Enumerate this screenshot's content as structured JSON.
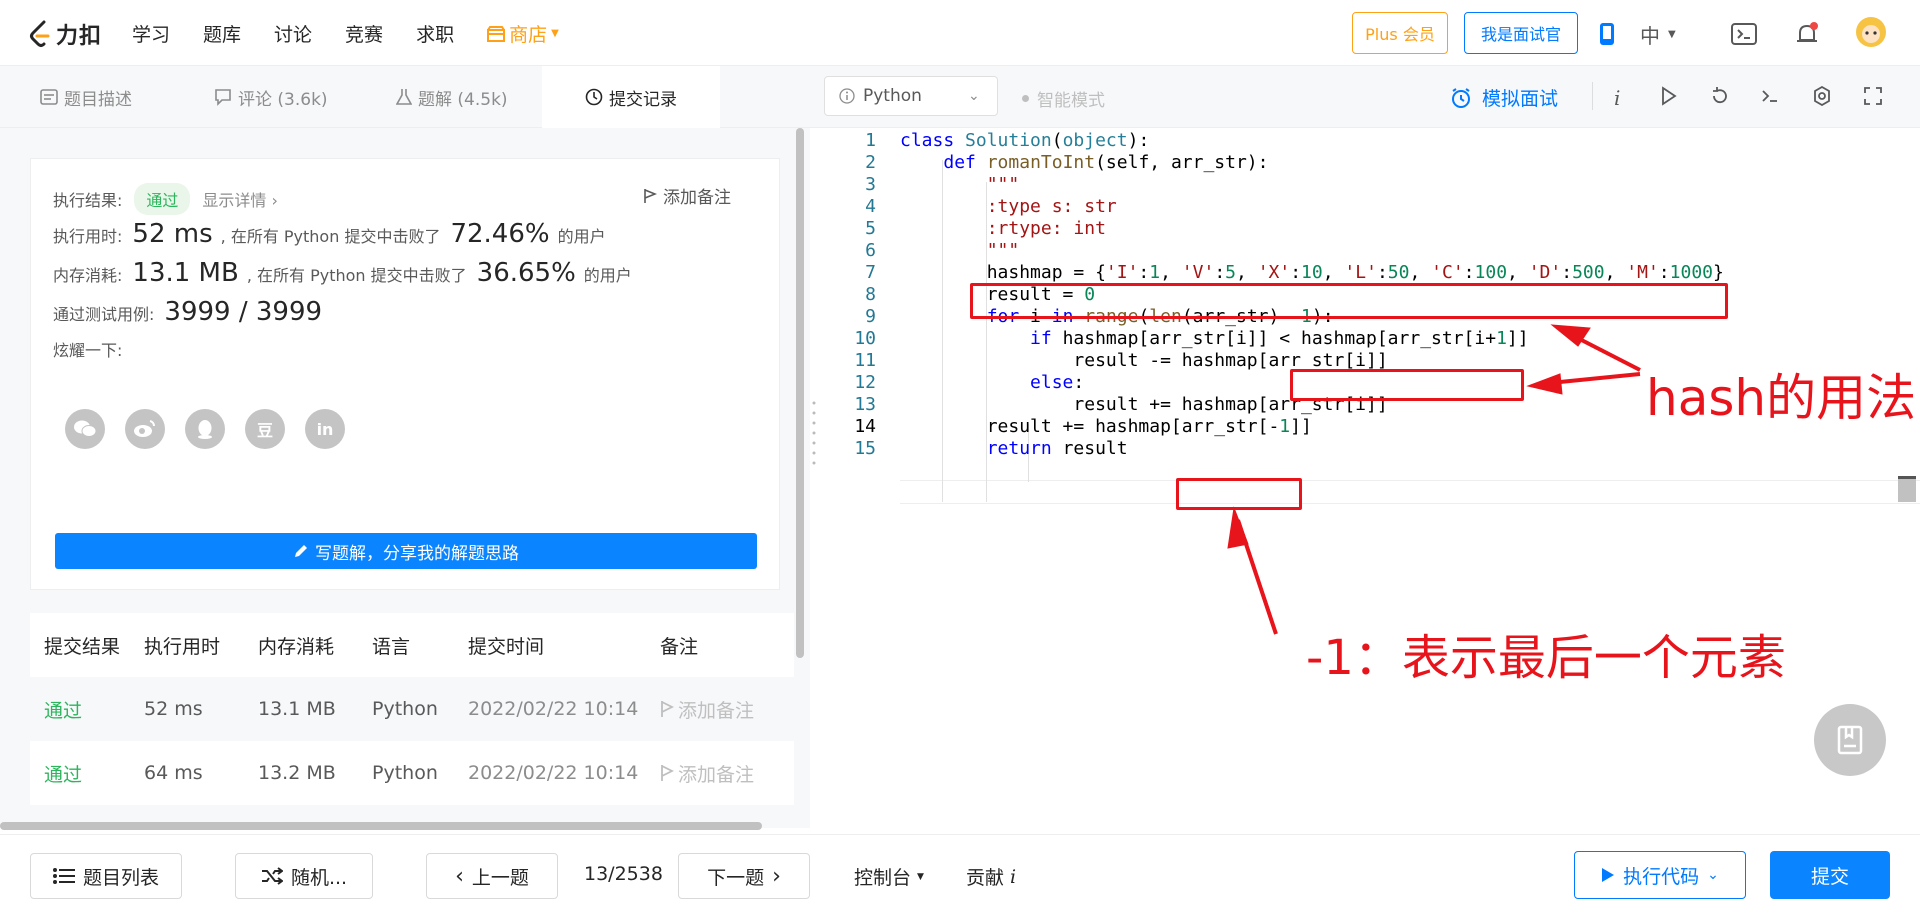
{
  "header": {
    "logo_text": "力扣",
    "nav": [
      "学习",
      "题库",
      "讨论",
      "竞赛",
      "求职"
    ],
    "shop": "商店",
    "plus": "Plus 会员",
    "interviewer": "我是面试官",
    "lang": "中"
  },
  "tabs": [
    {
      "label": "题目描述"
    },
    {
      "label": "评论 (3.6k)"
    },
    {
      "label": "题解 (4.5k)"
    },
    {
      "label": "提交记录"
    }
  ],
  "editor_bar": {
    "language": "Python",
    "smart_mode": "智能模式",
    "mock_interview": "模拟面试",
    "info_glyph": "i"
  },
  "result": {
    "label": "执行结果:",
    "status": "通过",
    "details": "显示详情 ›",
    "add_note": "添加备注",
    "time_label": "执行用时:",
    "time_value": "52 ms",
    "time_mid": ", 在所有 Python 提交中击败了",
    "time_percent": "72.46%",
    "users_suffix": "的用户",
    "mem_label": "内存消耗:",
    "mem_value": "13.1 MB",
    "mem_mid": ", 在所有 Python 提交中击败了",
    "mem_percent": "36.65%",
    "cases_label": "通过测试用例:",
    "cases_value": "3999 / 3999",
    "share_label": "炫耀一下:",
    "share_icons": [
      "wechat-icon",
      "weibo-icon",
      "qq-icon",
      "douban-icon",
      "linkedin-icon"
    ],
    "share_glyphs": [
      "",
      "",
      "",
      "豆",
      "in"
    ],
    "write_btn": "写题解，分享我的解题思路"
  },
  "submissions": {
    "headers": [
      "提交结果",
      "执行用时",
      "内存消耗",
      "语言",
      "提交时间",
      "备注"
    ],
    "rows": [
      {
        "status": "通过",
        "time": "52 ms",
        "memory": "13.1 MB",
        "language": "Python",
        "submitted": "2022/02/22 10:14",
        "note": "添加备注"
      },
      {
        "status": "通过",
        "time": "64 ms",
        "memory": "13.2 MB",
        "language": "Python",
        "submitted": "2022/02/22 10:14",
        "note": "添加备注"
      }
    ]
  },
  "code": {
    "line_numbers": [
      "1",
      "2",
      "3",
      "4",
      "5",
      "6",
      "7",
      "8",
      "9",
      "10",
      "11",
      "12",
      "13",
      "14",
      "15"
    ]
  },
  "annotations": {
    "hash_usage": "hash的用法",
    "last_element": "-1：表示最后一个元素"
  },
  "bottom": {
    "problem_list": "题目列表",
    "random": "随机...",
    "prev": "上一题",
    "page": "13/2538",
    "next": "下一题",
    "console": "控制台",
    "contribute": "贡献",
    "contribute_glyph": "i",
    "run": "执行代码",
    "submit": "提交"
  },
  "colors": {
    "accent": "#007aff",
    "pass": "#2db55d",
    "annotation": "#e8141c",
    "shop": "#ffa116"
  }
}
